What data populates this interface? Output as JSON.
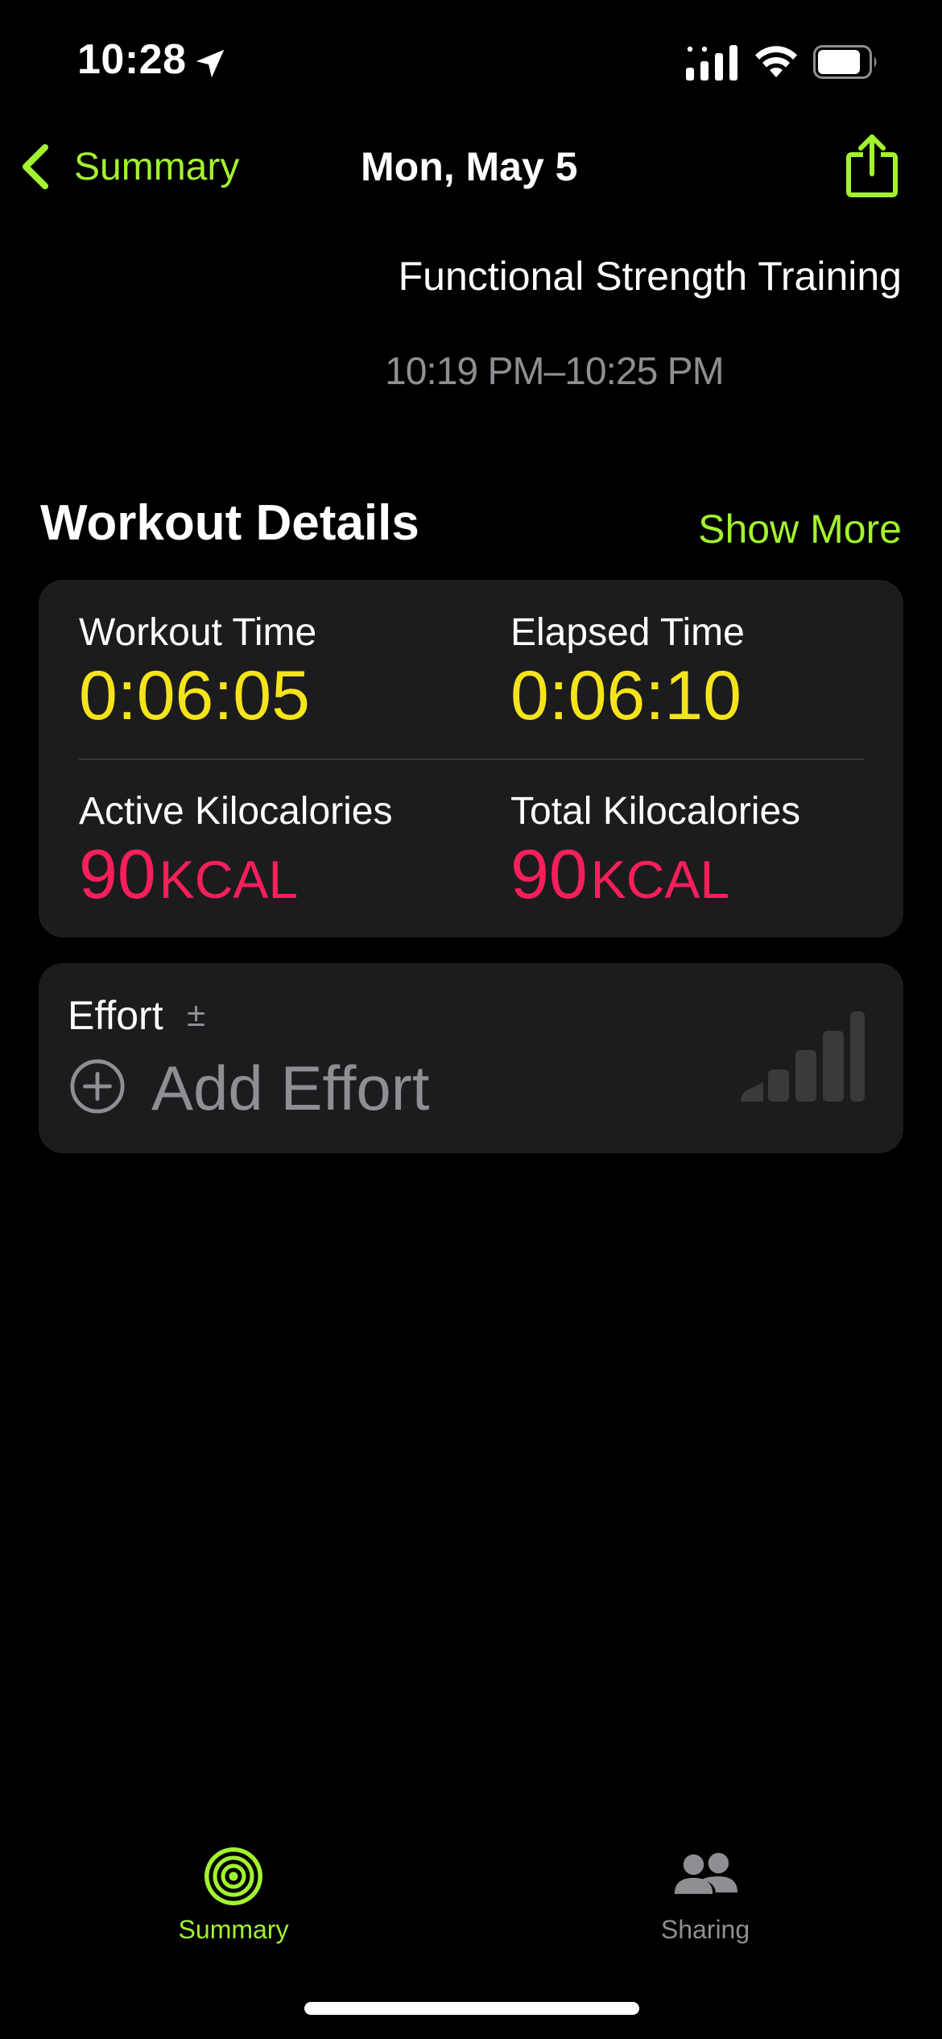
{
  "status_bar": {
    "time": "10:28"
  },
  "nav": {
    "back_label": "Summary",
    "title": "Mon, May 5"
  },
  "workout": {
    "name": "Functional Strength Training",
    "time_range": "10:19 PM–10:25 PM"
  },
  "details": {
    "section_title": "Workout Details",
    "show_more": "Show More",
    "metrics": [
      {
        "label": "Workout Time",
        "value": "0:06:05",
        "unit": ""
      },
      {
        "label": "Elapsed Time",
        "value": "0:06:10",
        "unit": ""
      },
      {
        "label": "Active Kilocalories",
        "value": "90",
        "unit": "KCAL"
      },
      {
        "label": "Total Kilocalories",
        "value": "90",
        "unit": "KCAL"
      }
    ]
  },
  "effort": {
    "label": "Effort",
    "plusminus": "±",
    "add_label": "Add Effort"
  },
  "tabs": [
    {
      "label": "Summary",
      "icon": "activity-rings-icon",
      "active": true
    },
    {
      "label": "Sharing",
      "icon": "people-icon",
      "active": false
    }
  ],
  "colors": {
    "accent": "#a3f22e",
    "time_value": "#f5e31c",
    "calorie_value": "#fa1f5a",
    "card_bg": "#1c1c1e",
    "secondary_text": "#8e8e93"
  }
}
